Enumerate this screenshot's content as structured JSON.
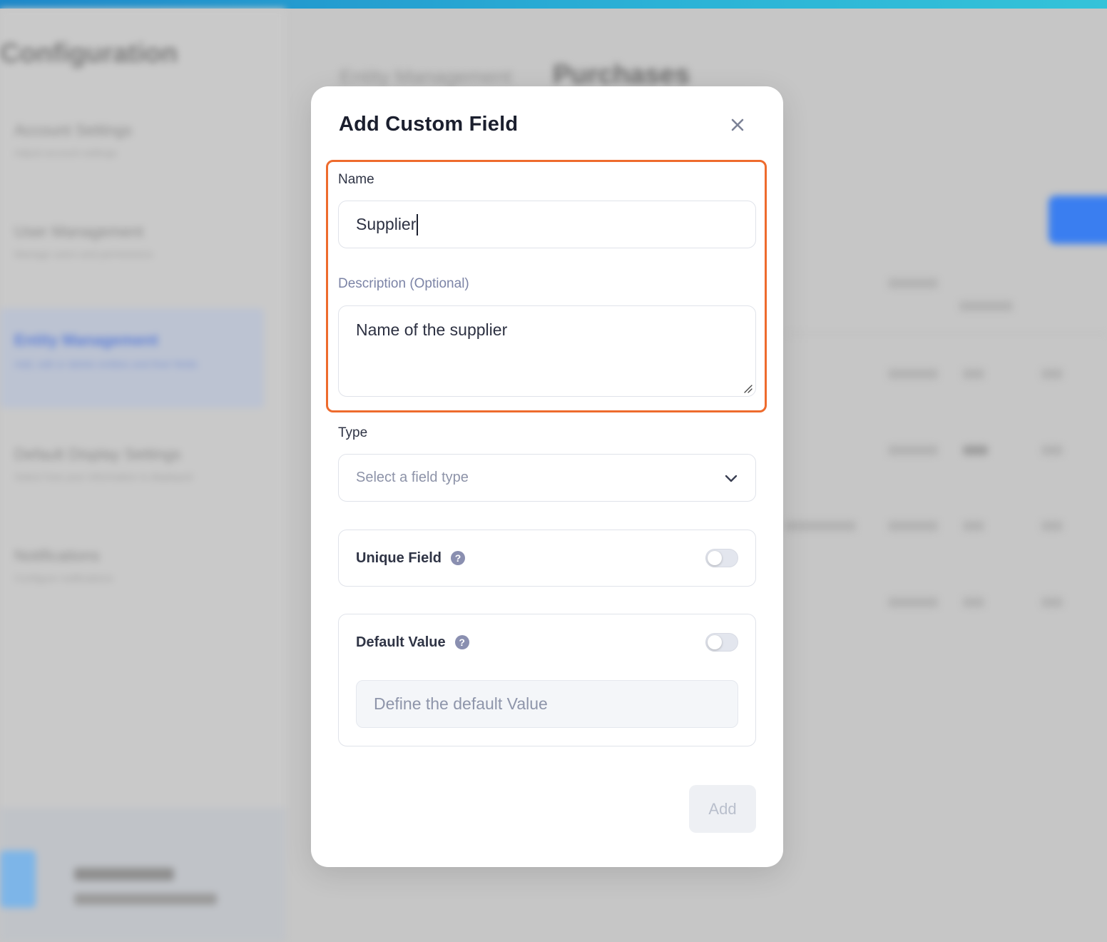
{
  "background": {
    "sidebar_title": "Configuration",
    "nav_items": [
      {
        "title": "Account Settings",
        "subtitle": "Adjust account settings"
      },
      {
        "title": "User Management",
        "subtitle": "Manage users and permissions"
      },
      {
        "title": "Entity Management",
        "subtitle": "Add, edit or delete entities and their fields"
      },
      {
        "title": "Default Display Settings",
        "subtitle": "Select how your information is displayed"
      },
      {
        "title": "Notifications",
        "subtitle": "Configure notifications"
      }
    ],
    "breadcrumb_parent": "Entity Management",
    "breadcrumb_current": "Purchases"
  },
  "modal": {
    "title": "Add Custom Field",
    "name_label": "Name",
    "name_value": "Supplier",
    "description_label": "Description (Optional)",
    "description_value": "Name of the supplier",
    "type_label": "Type",
    "type_placeholder": "Select a field type",
    "unique_field_label": "Unique Field",
    "default_value_label": "Default Value",
    "default_value_placeholder": "Define the default Value",
    "add_button": "Add",
    "help_glyph": "?",
    "close_glyph": "×"
  },
  "colors": {
    "highlight": "#ee6b2d",
    "top_strip": "#2bb2d6"
  },
  "icons": [
    "close-icon",
    "chevron-down-icon",
    "help-icon",
    "resize-grip-icon"
  ]
}
